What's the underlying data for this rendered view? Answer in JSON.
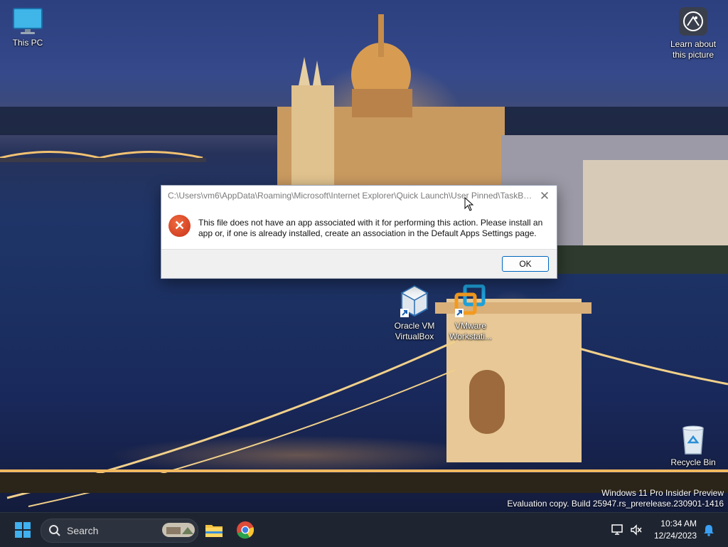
{
  "desktop": {
    "icons": [
      {
        "label": "This PC"
      },
      {
        "label": "Learn about this picture"
      },
      {
        "label": "Oracle VM VirtualBox"
      },
      {
        "label": "VMware Workstati..."
      },
      {
        "label": "Recycle Bin"
      }
    ]
  },
  "dialog": {
    "title": "C:\\Users\\vm6\\AppData\\Roaming\\Microsoft\\Internet Explorer\\Quick Launch\\User Pinned\\TaskBa...",
    "message": "This file does not have an app associated with it for performing this action. Please install an app or, if one is already installed, create an association in the Default Apps Settings page.",
    "ok_label": "OK",
    "icon": "error-icon"
  },
  "watermark": {
    "line1": "Windows 11 Pro Insider Preview",
    "line2": "Evaluation copy. Build 25947.rs_prerelease.230901-1416"
  },
  "taskbar": {
    "search_label": "Search",
    "apps": [
      "start-icon",
      "file-explorer-icon",
      "chrome-icon"
    ],
    "time": "10:34 AM",
    "date": "12/24/2023"
  },
  "colors": {
    "accent": "#0067c0",
    "error": "#d9431e",
    "taskbar": "#1f2530"
  }
}
